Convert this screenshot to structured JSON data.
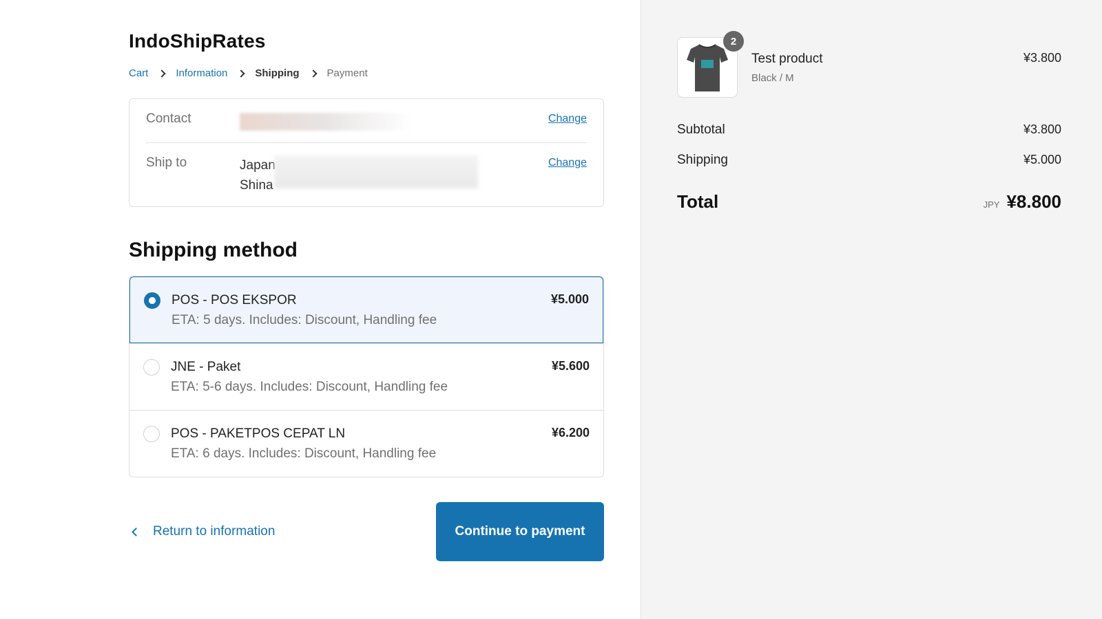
{
  "shop": {
    "name": "IndoShipRates"
  },
  "breadcrumb": {
    "items": [
      {
        "label": "Cart",
        "state": "link"
      },
      {
        "label": "Information",
        "state": "link"
      },
      {
        "label": "Shipping",
        "state": "current"
      },
      {
        "label": "Payment",
        "state": "pending"
      }
    ]
  },
  "review": {
    "contact": {
      "label": "Contact",
      "value": "",
      "change_label": "Change"
    },
    "ship_to": {
      "label": "Ship to",
      "line1": "Japan",
      "line2": "Shina",
      "change_label": "Change"
    }
  },
  "shipping_method": {
    "title": "Shipping method",
    "options": [
      {
        "name": "POS - POS EKSPOR",
        "eta": "ETA: 5 days. Includes: Discount, Handling fee",
        "price": "¥5.000",
        "selected": true
      },
      {
        "name": "JNE - Paket",
        "eta": "ETA: 5-6 days. Includes: Discount, Handling fee",
        "price": "¥5.600",
        "selected": false
      },
      {
        "name": "POS - PAKETPOS CEPAT LN",
        "eta": "ETA: 6 days. Includes: Discount, Handling fee",
        "price": "¥6.200",
        "selected": false
      }
    ]
  },
  "actions": {
    "return_label": "Return to information",
    "continue_label": "Continue to payment"
  },
  "summary": {
    "product": {
      "name": "Test product",
      "variant": "Black / M",
      "price": "¥3.800",
      "quantity": "2",
      "thumbnail_icon": "tshirt-icon"
    },
    "subtotal": {
      "label": "Subtotal",
      "value": "¥3.800"
    },
    "shipping": {
      "label": "Shipping",
      "value": "¥5.000"
    },
    "total": {
      "label": "Total",
      "currency": "JPY",
      "value": "¥8.800"
    }
  },
  "colors": {
    "accent": "#1773b0",
    "selected_bg": "#f0f5fd",
    "sidebar_bg": "#f4f4f4"
  }
}
